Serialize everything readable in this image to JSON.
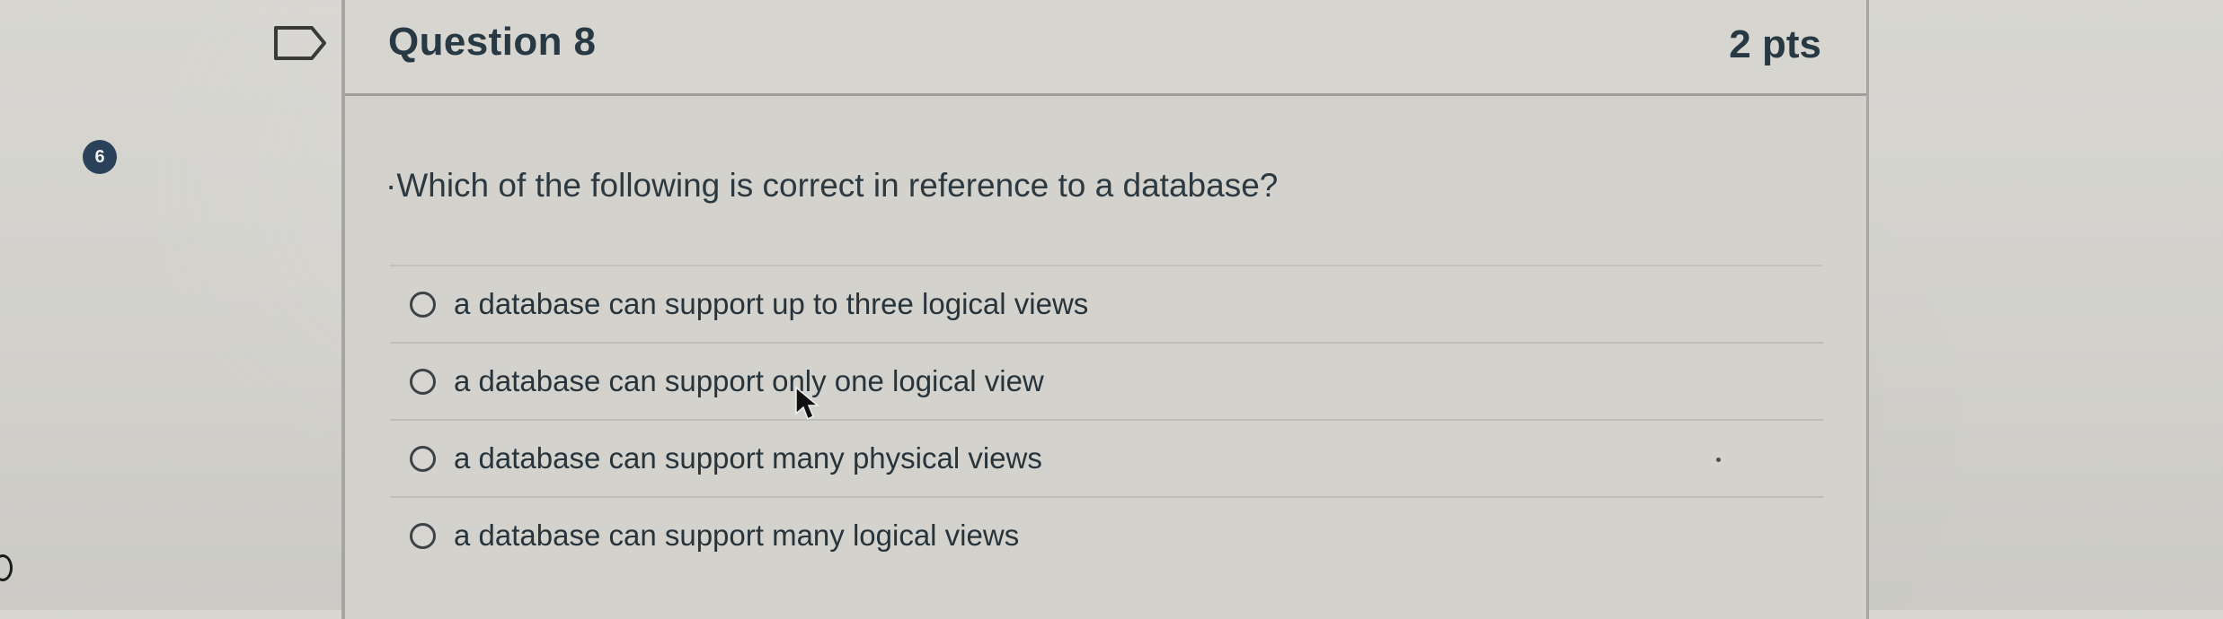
{
  "question": {
    "title": "Question 8",
    "points": "2 pts",
    "badge_number": "6",
    "prompt": "·Which of the following is correct in reference to a database?"
  },
  "options": [
    {
      "label": "a database can support up to three logical views"
    },
    {
      "label": "a database can support only one logical view"
    },
    {
      "label": "a database can support many physical views"
    },
    {
      "label": "a database can support many logical views"
    }
  ],
  "icons": {
    "flag": "flag-outline-icon",
    "cursor": "mouse-pointer-icon",
    "radio": "radio-button-icon"
  },
  "colors": {
    "badge_background": "#29425a",
    "title_text": "#283944",
    "border": "#a6a5a1"
  }
}
